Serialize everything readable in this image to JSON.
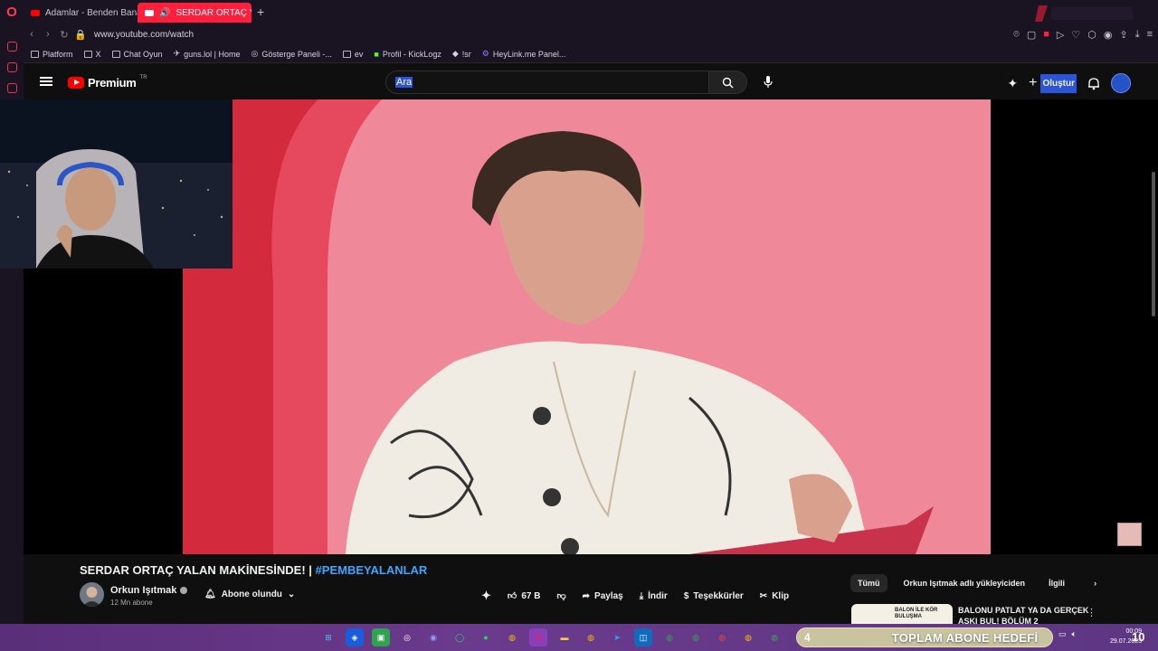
{
  "browser": {
    "tabs": [
      {
        "label": "Adamlar - Benden Bana -",
        "active": false
      },
      {
        "label": "SERDAR ORTAÇ YALAN",
        "active": true
      }
    ],
    "new_tab": "+",
    "url": "www.youtube.com/watch",
    "bookmarks": [
      "Platform",
      "X",
      "Chat Oyun",
      "guns.lol | Home",
      "Gösterge Paneli -...",
      "ev",
      "Profil - KickLogz",
      "!sr",
      "HeyLink.me Panel..."
    ]
  },
  "youtube": {
    "brand": "Premium",
    "region": "TR",
    "search_value": "Ara",
    "create_label": "Oluştur"
  },
  "video": {
    "title": "SERDAR ORTAÇ YALAN MAKİNESİNDE! |",
    "hashtag": "#PEMBEYALANLAR",
    "channel": "Orkun Işıtmak",
    "subscribers": "12 Mn abone",
    "subscribe_state": "Abone olundu",
    "likes": "67 B",
    "share": "Paylaş",
    "download": "İndir",
    "thanks": "Teşekkürler",
    "clip": "Klip"
  },
  "sidebar_chips": [
    "Tümü",
    "Orkun Işıtmak adlı yükleyiciden",
    "İlgili"
  ],
  "recommendation": {
    "title": "BALONU PATLAT YA DA GERÇEK AŞKI BUL! BÖLÜM 2",
    "thumb_text": "BALON İLE KÖR BULUŞMA"
  },
  "taskbar": {
    "goal_number": "4",
    "goal_text": "TOPLAM ABONE HEDEFİ",
    "time": "00:09",
    "date": "29.07.2023",
    "notification_count": "10"
  },
  "colors": {
    "accent": "#ff1f3d",
    "link": "#3ea6ff",
    "yt_red": "#ff0000"
  }
}
